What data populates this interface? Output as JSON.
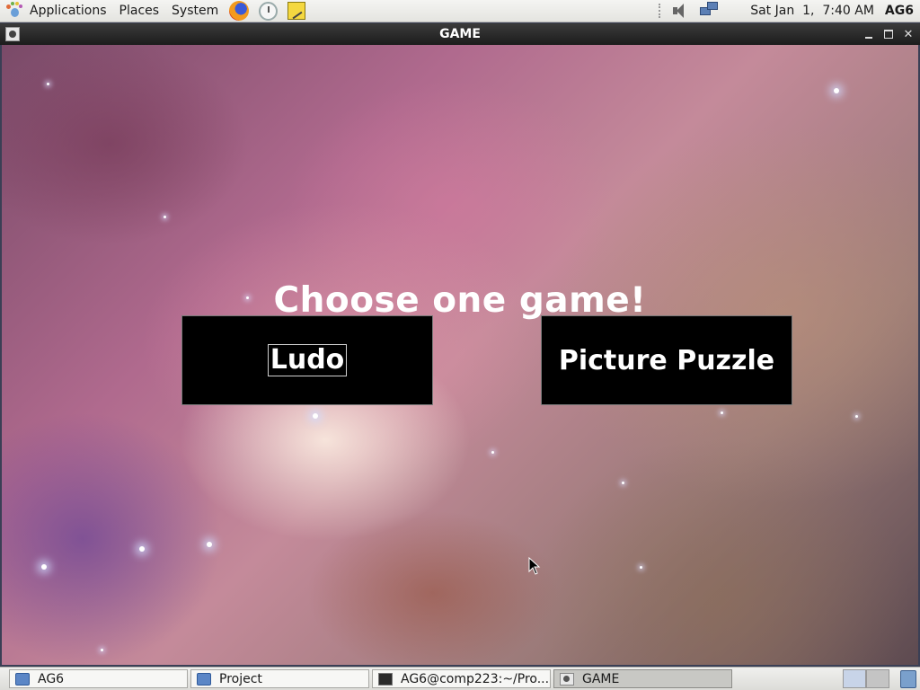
{
  "top_panel": {
    "menus": [
      "Applications",
      "Places",
      "System"
    ],
    "launchers": [
      "firefox-icon",
      "clock-icon",
      "notes-icon"
    ],
    "datetime": "Sat Jan  1,  7:40 AM",
    "user": "AG6"
  },
  "window": {
    "title": "GAME",
    "controls": [
      "minimize",
      "maximize",
      "close"
    ],
    "close_glyph": "✕"
  },
  "game": {
    "heading": "Choose one game!",
    "buttons": {
      "ludo": "Ludo",
      "puzzle": "Picture Puzzle"
    },
    "focused_button": "ludo"
  },
  "taskbar": {
    "tasks": [
      {
        "label": "AG6",
        "icon": "folder-icon"
      },
      {
        "label": "Project",
        "icon": "folder-icon"
      },
      {
        "label": "AG6@comp223:~/Pro...",
        "icon": "terminal-icon"
      },
      {
        "label": "GAME",
        "icon": "game-icon",
        "active": true
      }
    ]
  },
  "colors": {
    "button_bg": "#000000",
    "button_text": "#ffffff",
    "heading_text": "#ffffff",
    "titlebar_bg": "#2a2a2a"
  }
}
